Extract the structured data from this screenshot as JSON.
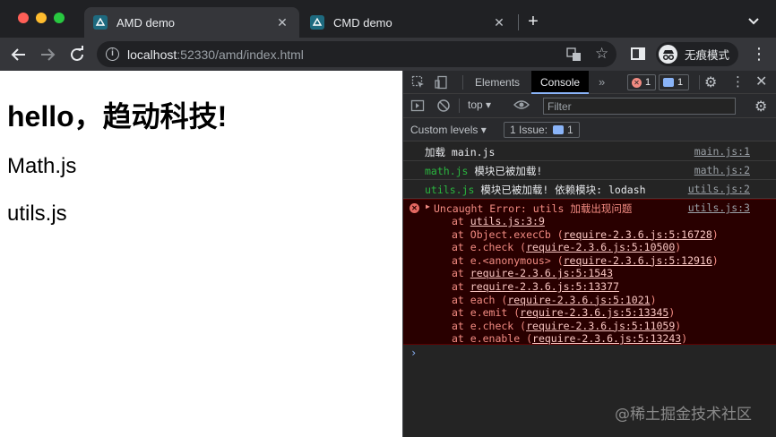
{
  "tabs": [
    {
      "title": "AMD demo",
      "active": true
    },
    {
      "title": "CMD demo",
      "active": false
    }
  ],
  "toolbar": {
    "url_host": "localhost",
    "url_rest": ":52330/amd/index.html",
    "profile_label": "无痕模式"
  },
  "page": {
    "heading": "hello，趋动科技!",
    "line1": "Math.js",
    "line2": "utils.js"
  },
  "devtools": {
    "tabs": [
      "Elements",
      "Console"
    ],
    "active_tab": "Console",
    "error_count": "1",
    "info_count": "1",
    "context": "top ▾",
    "filter_placeholder": "Filter",
    "levels_label": "Custom levels ▾",
    "issues_label": "1 Issue:",
    "issues_count": "1"
  },
  "console": {
    "logs": [
      {
        "prefix": "",
        "text": "加载 main.js",
        "source": "main.js:1"
      },
      {
        "prefix": "math.js",
        "text": " 模块已被加载!",
        "source": "math.js:2"
      },
      {
        "prefix": "utils.js",
        "text": " 模块已被加载! 依赖模块: lodash",
        "source": "utils.js:2"
      }
    ],
    "error": {
      "message": "Uncaught Error: utils 加载出现问题",
      "source": "utils.js:3",
      "stack": [
        {
          "pre": "at ",
          "link": "utils.js:3:9",
          "post": ""
        },
        {
          "pre": "at Object.execCb (",
          "link": "require-2.3.6.js:5:16728",
          "post": ")"
        },
        {
          "pre": "at e.check (",
          "link": "require-2.3.6.js:5:10500",
          "post": ")"
        },
        {
          "pre": "at e.<anonymous> (",
          "link": "require-2.3.6.js:5:12916",
          "post": ")"
        },
        {
          "pre": "at ",
          "link": "require-2.3.6.js:5:1543",
          "post": ""
        },
        {
          "pre": "at ",
          "link": "require-2.3.6.js:5:13377",
          "post": ""
        },
        {
          "pre": "at each (",
          "link": "require-2.3.6.js:5:1021",
          "post": ")"
        },
        {
          "pre": "at e.emit (",
          "link": "require-2.3.6.js:5:13345",
          "post": ")"
        },
        {
          "pre": "at e.check (",
          "link": "require-2.3.6.js:5:11059",
          "post": ")"
        },
        {
          "pre": "at e.enable (",
          "link": "require-2.3.6.js:5:13243",
          "post": ")"
        }
      ]
    },
    "prompt": "›"
  },
  "watermark": "@稀土掘金技术社区",
  "colors": {
    "error_bg": "#290000",
    "error_text": "#f28b82",
    "module_green": "#2ab53f"
  }
}
